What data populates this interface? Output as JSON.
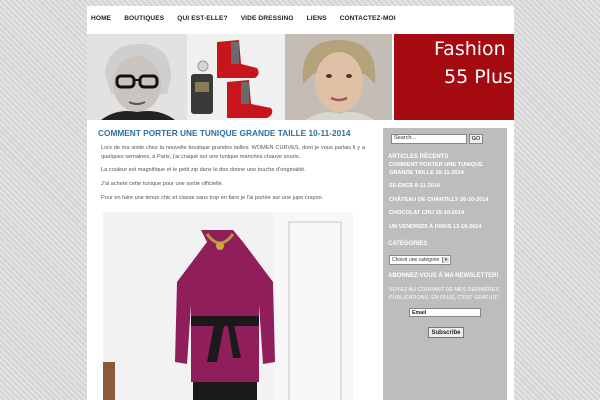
{
  "nav": {
    "items": [
      {
        "label": "HOME"
      },
      {
        "label": "BOUTIQUES"
      },
      {
        "label": "QUI EST-ELLE?"
      },
      {
        "label": "VIDE DRESSING"
      },
      {
        "label": "LIENS"
      },
      {
        "label": "CONTACTEZ-MOI"
      }
    ]
  },
  "banner": {
    "title_line1": "Fashion",
    "title_line2": "55 Plus",
    "accent_color": "#a40a10"
  },
  "post": {
    "title": "COMMENT PORTER UNE TUNIQUE GRANDE TAILLE 10-11-2014",
    "paragraphs": [
      "Lors de ma visite chez la nouvelle boutique grandes tailles: WOMEN CURVES, dont je vous parlais il y a quelques semaines, à Paris, j'ai craqué sur une tunique manches chauve souris.",
      "La couleur est magnifique et le petit zip dans le dos donne une touche d'originalité.",
      "J'ai acheté cette tunique pour une sortie officielle.",
      "Pour en faire une tenue chic et classe sans trop en faire je l'ai portée sur une jupe crayon."
    ],
    "title_color": "#2f6f9f"
  },
  "sidebar": {
    "search_value": "Search...",
    "search_button": "GO",
    "recent_heading": "ARTICLES RÉCENTS",
    "recent_items": [
      "COMMENT PORTER UNE TUNIQUE GRANDE TAILLE 10-11-2014",
      "SILENCE 8-11-2014",
      "CHÂTEAU DE CHANTILLY 26-10-2014",
      "CHOCOLAT CRU 15-10-2014",
      "UN VENDREDI À PARIS 13-10-2014"
    ],
    "categories_heading": "CATÉGORIES",
    "categories_select": "Choisir une catégorie",
    "newsletter_heading": "ABONNEZ-VOUS À MA NEWSLETTER!",
    "newsletter_text": "SOYEZ AU COURANT DE MES DERNIÈRES PUBLICATIONS. EN PLUS, C'EST GRATUIT!",
    "email_value": "Email",
    "subscribe_label": "Subscribe",
    "background_color": "#bdbdbd"
  }
}
